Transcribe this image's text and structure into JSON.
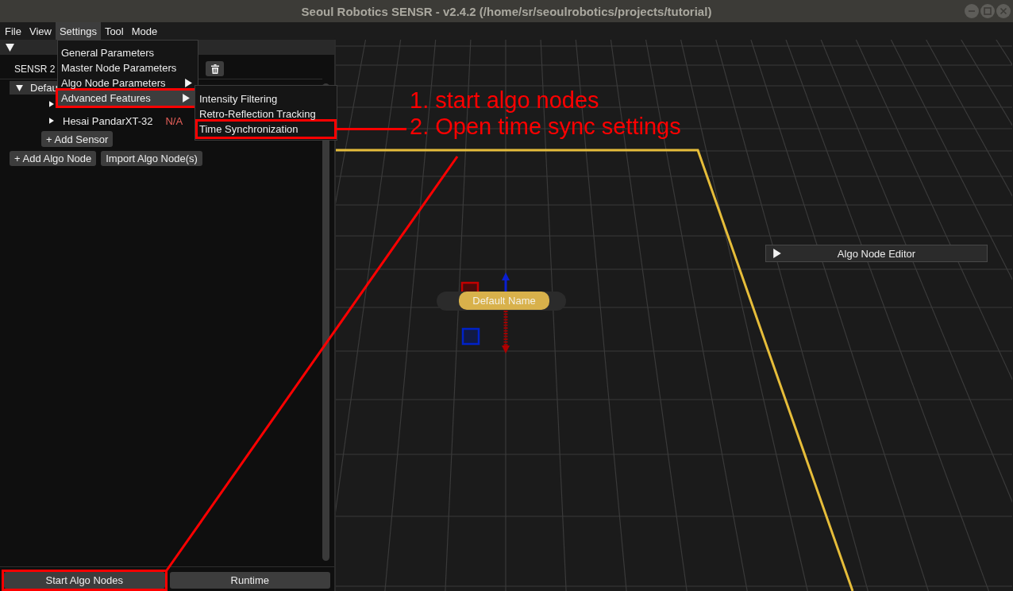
{
  "window": {
    "title": "Seoul Robotics SENSR - v2.4.2 (/home/sr/seoulrobotics/projects/tutorial)"
  },
  "menu_bar": [
    {
      "label": "File",
      "selected": false
    },
    {
      "label": "View",
      "selected": false
    },
    {
      "label": "Settings",
      "selected": true
    },
    {
      "label": "Tool",
      "selected": false
    },
    {
      "label": "Mode",
      "selected": false
    }
  ],
  "settings_menu": {
    "items": [
      {
        "label": "General Parameters",
        "submenu": false,
        "selected": false,
        "annotated": false
      },
      {
        "label": "Master Node Parameters",
        "submenu": false,
        "selected": false,
        "annotated": false
      },
      {
        "label": "Algo Node Parameters",
        "submenu": true,
        "selected": false,
        "annotated": false
      },
      {
        "label": "Advanced Features",
        "submenu": true,
        "selected": true,
        "annotated": true
      }
    ]
  },
  "advanced_features_submenu": {
    "items": [
      {
        "label": "Intensity Filtering",
        "selected": false,
        "annotated": false
      },
      {
        "label": "Retro-Reflection Tracking",
        "selected": false,
        "annotated": false
      },
      {
        "label": "Time Synchronization",
        "selected": false,
        "annotated": true
      }
    ]
  },
  "project_panel": {
    "expanded": true,
    "master": "SENSR 2",
    "algo_nodes": [
      {
        "label": "Defau",
        "expanded": true,
        "selected": true,
        "children": [
          {
            "expanded": false,
            "selected": false
          },
          {
            "label": "Hesai PandarXT-32",
            "status": "N/A",
            "expanded": false,
            "selected": false
          }
        ],
        "add_sensor_button": "+ Add Sensor"
      }
    ],
    "actions": [
      "+ Add Algo Node",
      "Import Algo Node(s)"
    ]
  },
  "footer_buttons": [
    {
      "label": "Start Algo Nodes",
      "annotated": true
    },
    {
      "label": "Runtime",
      "annotated": false
    }
  ],
  "viewport": {
    "node": {
      "label": "Default Name"
    },
    "editor_panel": {
      "title": "Algo Node Editor",
      "expanded": false
    }
  },
  "annotations": {
    "steps": [
      "1. start algo nodes",
      "2. Open time sync settings"
    ]
  }
}
